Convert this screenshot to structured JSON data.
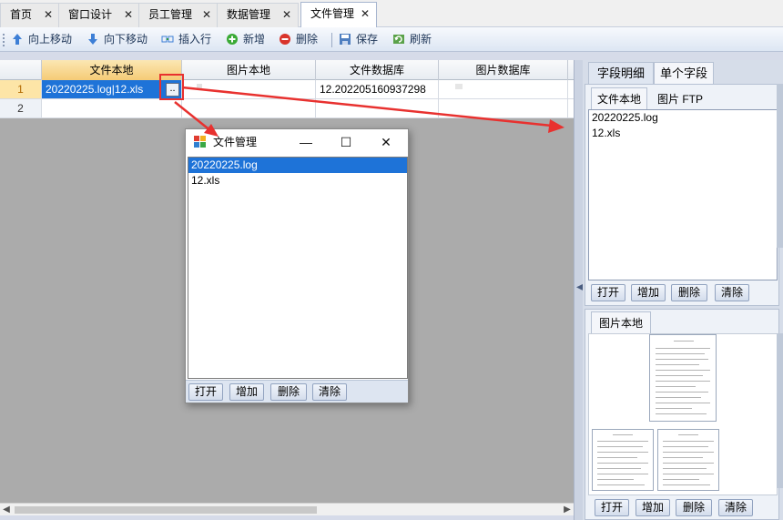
{
  "tabs": [
    {
      "label": "首页",
      "close": "✕"
    },
    {
      "label": "窗口设计",
      "close": "✕"
    },
    {
      "label": "员工管理",
      "close": "✕"
    },
    {
      "label": "数据管理",
      "close": "✕"
    },
    {
      "label": "文件管理",
      "close": "✕",
      "active": true
    }
  ],
  "toolbar": {
    "move_up": "向上移动",
    "move_down": "向下移动",
    "insert_row": "插入行",
    "add_new": "新增",
    "delete": "删除",
    "save": "保存",
    "refresh": "刷新"
  },
  "grid": {
    "columns": [
      "文件本地",
      "图片本地",
      "文件数据库",
      "图片数据库"
    ],
    "rows": [
      {
        "num": "1",
        "file_local": "20220225.log|12.xls",
        "ellipsis": "..",
        "file_db": "12.202205160937298"
      },
      {
        "num": "2",
        "file_local": "",
        "file_db": ""
      }
    ]
  },
  "dialog": {
    "title": "文件管理",
    "minimize": "—",
    "maximize": "☐",
    "close": "✕",
    "items": [
      "20220225.log",
      "12.xls"
    ],
    "buttons": {
      "open": "打开",
      "add": "增加",
      "delete": "删除",
      "clear": "清除"
    }
  },
  "right_panel": {
    "tabs": {
      "field_detail": "字段明细",
      "single_field": "单个字段"
    },
    "file_tabs": {
      "file_local": "文件本地",
      "image_ftp": "图片 FTP"
    },
    "file_items": [
      "20220225.log",
      "12.xls"
    ],
    "file_buttons": {
      "open": "打开",
      "add": "增加",
      "delete": "删除",
      "clear": "清除"
    },
    "image_tab": "图片本地",
    "image_buttons": {
      "open": "打开",
      "add": "增加",
      "delete": "删除",
      "clear": "清除"
    }
  },
  "colors": {
    "selection": "#1e73d8",
    "annotation_red": "#e8312f",
    "header_highlight": "#f5cb76"
  }
}
